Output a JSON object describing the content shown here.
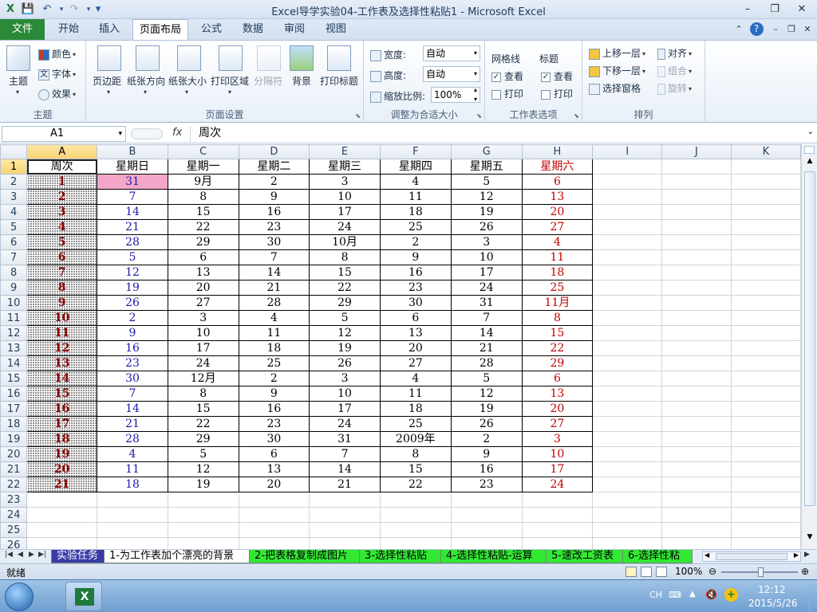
{
  "window": {
    "title": "Excel导学实验04-工作表及选择性粘贴1 - Microsoft Excel",
    "minimize": "–",
    "restore": "❐",
    "close": "✕"
  },
  "quick_access": {
    "save": "💾",
    "undo": "↶",
    "redo": "↷",
    "customize": "▾"
  },
  "tabs": [
    {
      "label": "文件"
    },
    {
      "label": "开始"
    },
    {
      "label": "插入"
    },
    {
      "label": "页面布局"
    },
    {
      "label": "公式"
    },
    {
      "label": "数据"
    },
    {
      "label": "审阅"
    },
    {
      "label": "视图"
    }
  ],
  "ribbon": {
    "themes": {
      "label": "主题",
      "group": "主题",
      "colors": "颜色",
      "fonts": "字体",
      "effects": "效果"
    },
    "page_setup": {
      "group": "页面设置",
      "margins": "页边距",
      "orientation": "纸张方向",
      "size": "纸张大小",
      "print_area": "打印区域",
      "breaks": "分隔符",
      "background": "背景",
      "print_titles": "打印标题"
    },
    "scale": {
      "group": "调整为合适大小",
      "width_label": "宽度:",
      "width_value": "自动",
      "height_label": "高度:",
      "height_value": "自动",
      "zoom_label": "缩放比例:",
      "zoom_value": "100%"
    },
    "sheet_options": {
      "group": "工作表选项",
      "gridlines": "网格线",
      "headings": "标题",
      "view": "查看",
      "print": "打印"
    },
    "arrange": {
      "group": "排列",
      "bring_forward": "上移一层",
      "send_backward": "下移一层",
      "selection_pane": "选择窗格",
      "align": "对齐",
      "group_btn": "组合",
      "rotate": "旋转"
    }
  },
  "formula_bar": {
    "name_box": "A1",
    "fx": "fx",
    "content": "周次"
  },
  "columns": [
    "A",
    "B",
    "C",
    "D",
    "E",
    "F",
    "G",
    "H",
    "I",
    "J",
    "K"
  ],
  "table": {
    "header": [
      "周次",
      "星期日",
      "星期一",
      "星期二",
      "星期三",
      "星期四",
      "星期五",
      "星期六"
    ],
    "rows": [
      [
        "1",
        "31",
        "9月",
        "2",
        "3",
        "4",
        "5",
        "6"
      ],
      [
        "2",
        "7",
        "8",
        "9",
        "10",
        "11",
        "12",
        "13"
      ],
      [
        "3",
        "14",
        "15",
        "16",
        "17",
        "18",
        "19",
        "20"
      ],
      [
        "4",
        "21",
        "22",
        "23",
        "24",
        "25",
        "26",
        "27"
      ],
      [
        "5",
        "28",
        "29",
        "30",
        "10月",
        "2",
        "3",
        "4"
      ],
      [
        "6",
        "5",
        "6",
        "7",
        "8",
        "9",
        "10",
        "11"
      ],
      [
        "7",
        "12",
        "13",
        "14",
        "15",
        "16",
        "17",
        "18"
      ],
      [
        "8",
        "19",
        "20",
        "21",
        "22",
        "23",
        "24",
        "25"
      ],
      [
        "9",
        "26",
        "27",
        "28",
        "29",
        "30",
        "31",
        "11月"
      ],
      [
        "10",
        "2",
        "3",
        "4",
        "5",
        "6",
        "7",
        "8"
      ],
      [
        "11",
        "9",
        "10",
        "11",
        "12",
        "13",
        "14",
        "15"
      ],
      [
        "12",
        "16",
        "17",
        "18",
        "19",
        "20",
        "21",
        "22"
      ],
      [
        "13",
        "23",
        "24",
        "25",
        "26",
        "27",
        "28",
        "29"
      ],
      [
        "14",
        "30",
        "12月",
        "2",
        "3",
        "4",
        "5",
        "6"
      ],
      [
        "15",
        "7",
        "8",
        "9",
        "10",
        "11",
        "12",
        "13"
      ],
      [
        "16",
        "14",
        "15",
        "16",
        "17",
        "18",
        "19",
        "20"
      ],
      [
        "17",
        "21",
        "22",
        "23",
        "24",
        "25",
        "26",
        "27"
      ],
      [
        "18",
        "28",
        "29",
        "30",
        "31",
        "2009年",
        "2",
        "3"
      ],
      [
        "19",
        "4",
        "5",
        "6",
        "7",
        "8",
        "9",
        "10"
      ],
      [
        "20",
        "11",
        "12",
        "13",
        "14",
        "15",
        "16",
        "17"
      ],
      [
        "21",
        "18",
        "19",
        "20",
        "21",
        "22",
        "23",
        "24"
      ]
    ],
    "empty_row_numbers": [
      "23",
      "24",
      "25",
      "26"
    ]
  },
  "sheet_tabs": [
    {
      "label": "实验任务",
      "bg": "#3a3aa8",
      "color": "#ffffff"
    },
    {
      "label": "1-为工作表加个漂亮的背景",
      "bg": "#ffffff",
      "color": "#000000"
    },
    {
      "label": "2-把表格复制成图片",
      "bg": "#33e833",
      "color": "#000000"
    },
    {
      "label": "3-选择性粘贴",
      "bg": "#33e833",
      "color": "#000000"
    },
    {
      "label": "4-选择性粘贴-运算",
      "bg": "#33e833",
      "color": "#000000"
    },
    {
      "label": "5-速改工资表",
      "bg": "#33e833",
      "color": "#000000"
    },
    {
      "label": "6-选择性粘",
      "bg": "#33e833",
      "color": "#000000"
    }
  ],
  "status": {
    "ready": "就绪",
    "zoom": "100%"
  },
  "taskbar": {
    "lang": "CH",
    "time": "12:12",
    "date": "2015/5/26"
  }
}
